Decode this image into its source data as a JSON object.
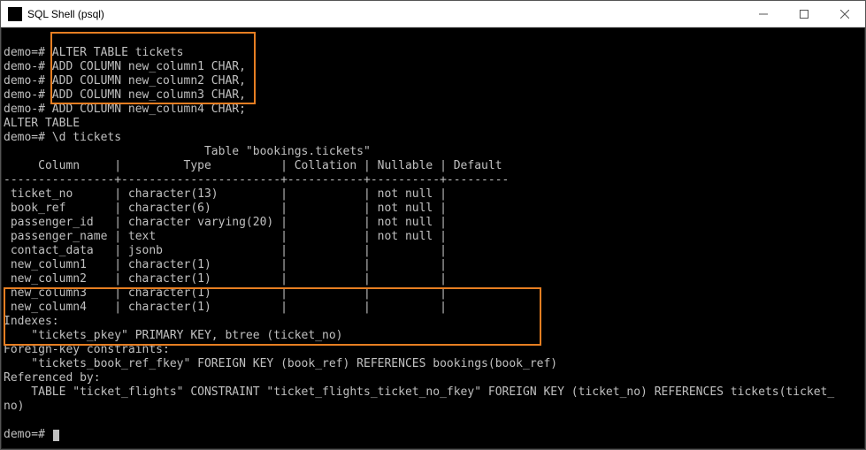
{
  "window": {
    "title": "SQL Shell (psql)"
  },
  "prompts": {
    "main": "demo=# ",
    "cont": "demo-# "
  },
  "query": {
    "line1": "ALTER TABLE tickets",
    "line2": "ADD COLUMN new_column1 CHAR,",
    "line3": "ADD COLUMN new_column2 CHAR,",
    "line4": "ADD COLUMN new_column3 CHAR,",
    "line5": "ADD COLUMN new_column4 CHAR;"
  },
  "response": {
    "alter": "ALTER TABLE",
    "describe_cmd": "\\d tickets",
    "table_title_line": "                             Table \"bookings.tickets\"",
    "header": "     Column     |         Type          | Collation | Nullable | Default",
    "divider": "----------------+-----------------------+-----------+----------+---------",
    "rows": {
      "r0": " ticket_no      | character(13)         |           | not null |",
      "r1": " book_ref       | character(6)          |           | not null |",
      "r2": " passenger_id   | character varying(20) |           | not null |",
      "r3": " passenger_name | text                  |           | not null |",
      "r4": " contact_data   | jsonb                 |           |          |",
      "r5": " new_column1    | character(1)          |           |          |",
      "r6": " new_column2    | character(1)          |           |          |",
      "r7": " new_column3    | character(1)          |           |          |",
      "r8": " new_column4    | character(1)          |           |          |"
    },
    "indexes_label": "Indexes:",
    "indexes_line": "    \"tickets_pkey\" PRIMARY KEY, btree (ticket_no)",
    "fk_label": "Foreign-key constraints:",
    "fk_line": "    \"tickets_book_ref_fkey\" FOREIGN KEY (book_ref) REFERENCES bookings(book_ref)",
    "refby_label": "Referenced by:",
    "refby_line": "    TABLE \"ticket_flights\" CONSTRAINT \"ticket_flights_ticket_no_fkey\" FOREIGN KEY (ticket_no) REFERENCES tickets(ticket_",
    "refby_wrap": "no)"
  }
}
